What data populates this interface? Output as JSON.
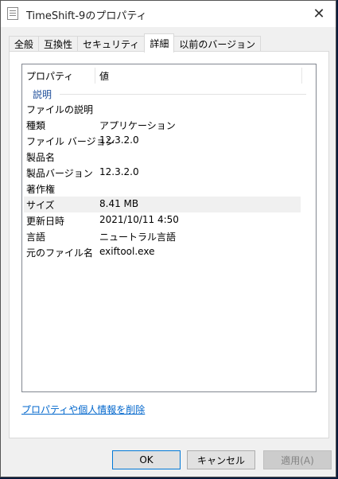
{
  "window": {
    "title": "TimeShift-9のプロパティ",
    "close_symbol": "✕"
  },
  "tabs": [
    {
      "label": "全般",
      "active": false
    },
    {
      "label": "互換性",
      "active": false
    },
    {
      "label": "セキュリティ",
      "active": false
    },
    {
      "label": "詳細",
      "active": true
    },
    {
      "label": "以前のバージョン",
      "active": false
    }
  ],
  "details": {
    "column_headers": {
      "property": "プロパティ",
      "value": "値"
    },
    "group": "説明",
    "rows": [
      {
        "name": "ファイルの説明",
        "value": ""
      },
      {
        "name": "種類",
        "value": "アプリケーション"
      },
      {
        "name": "ファイル バージョン",
        "value": "12.3.2.0"
      },
      {
        "name": "製品名",
        "value": ""
      },
      {
        "name": "製品バージョン",
        "value": "12.3.2.0"
      },
      {
        "name": "著作権",
        "value": ""
      },
      {
        "name": "サイズ",
        "value": "8.41 MB"
      },
      {
        "name": "更新日時",
        "value": "2021/10/11 4:50"
      },
      {
        "name": "言語",
        "value": "ニュートラル言語"
      },
      {
        "name": "元のファイル名",
        "value": "exiftool.exe"
      }
    ],
    "remove_link": "プロパティや個人情報を削除"
  },
  "buttons": {
    "ok": "OK",
    "cancel": "キャンセル",
    "apply": "適用(A)"
  }
}
